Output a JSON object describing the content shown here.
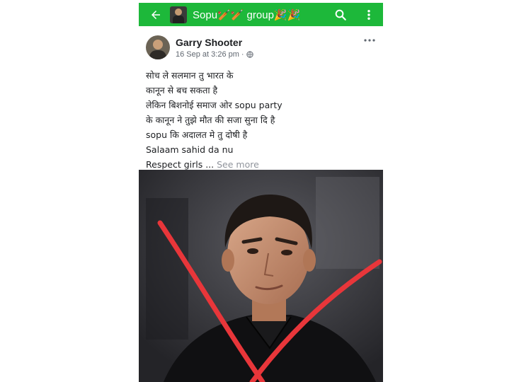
{
  "header": {
    "group_name": "Sopu🏏🏏 group🎉🎉",
    "bg_color": "#1db83a",
    "icons": [
      "back-arrow-icon",
      "search-icon",
      "more-vertical-icon"
    ]
  },
  "post": {
    "author": "Garry Shooter",
    "date": "16 Sep at 3:26 pm",
    "separator": "·",
    "privacy_icon": "globe-icon",
    "lines": [
      "सोच ले सलमान तु भारत के",
      "कानून से बच सकता है",
      "लेकिन बिशनोई समाज ओर sopu party",
      "के कानून ने तुझे मौत की सजा सुना दि है",
      "sopu कि अदालत मे तु दोषी है",
      "Salaam sahid da nu",
      "Respect girls ..."
    ],
    "see_more": "See more",
    "image": {
      "subject": "man-in-black-shirt-photo",
      "overlay": "red-x-mark",
      "overlay_color": "#e8363a"
    }
  }
}
